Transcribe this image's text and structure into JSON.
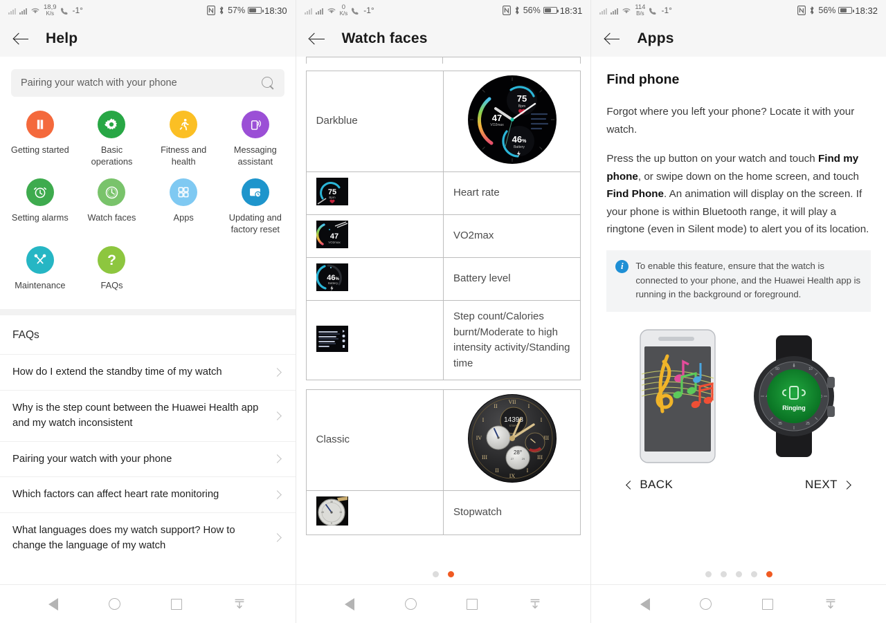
{
  "panels": [
    {
      "statusbar": {
        "net_rate_num": "18,9",
        "net_rate_unit": "K/s",
        "temp": "-1°",
        "nfc": "N",
        "bluetooth": "✽",
        "battery_pct": "57%",
        "clock": "18:30"
      },
      "appbar": {
        "title": "Help",
        "back_icon": "back-arrow-icon"
      },
      "search": {
        "value": "Pairing your watch with your phone",
        "icon": "search-icon"
      },
      "tiles": [
        {
          "label": "Getting started",
          "color": "#F4693C",
          "icon": "book-icon"
        },
        {
          "label": "Basic operations",
          "color": "#28A745",
          "icon": "gear-icon"
        },
        {
          "label": "Fitness and health",
          "color": "#FBBF24",
          "icon": "runner-icon"
        },
        {
          "label": "Messaging assistant",
          "color": "#9B4FD6",
          "icon": "phone-signal-icon"
        },
        {
          "label": "Setting alarms",
          "color": "#3EAB4E",
          "icon": "alarm-clock-icon"
        },
        {
          "label": "Watch faces",
          "color": "#79C36B",
          "icon": "clock-icon"
        },
        {
          "label": "Apps",
          "color": "#7FC9F2",
          "icon": "grid-apps-icon"
        },
        {
          "label": "Updating and factory reset",
          "color": "#1E95CC",
          "icon": "update-card-icon"
        },
        {
          "label": "Maintenance",
          "color": "#26B6C4",
          "icon": "tools-icon"
        },
        {
          "label": "FAQs",
          "color": "#8DC63F",
          "icon": "question-mark-icon"
        }
      ],
      "faq_section_title": "FAQs",
      "faqs": [
        "How do I extend the standby time of my watch",
        "Why is the step count between the Huawei Health app and my watch inconsistent",
        "Pairing your watch with your phone",
        "Which factors can affect heart rate monitoring",
        "What languages does my watch support? How to change the language of my watch"
      ]
    },
    {
      "statusbar": {
        "net_rate_num": "0",
        "net_rate_unit": "K/s",
        "temp": "-1°",
        "nfc": "N",
        "bluetooth": "✽",
        "battery_pct": "56%",
        "clock": "18:31"
      },
      "appbar": {
        "title": "Watch faces",
        "back_icon": "back-arrow-icon"
      },
      "table_rows": [
        {
          "type": "face",
          "name": "Darkblue",
          "art": "darkblue-face"
        },
        {
          "type": "thumb",
          "art": "heart-rate-thumb",
          "label": "Heart rate"
        },
        {
          "type": "thumb",
          "art": "vo2max-thumb",
          "label": "VO2max"
        },
        {
          "type": "thumb",
          "art": "battery-thumb",
          "label": "Battery level"
        },
        {
          "type": "thumb",
          "art": "activity-thumb",
          "label": "Step count/Calories burnt/Moderate to high intensity activity/Standing time"
        },
        {
          "type": "face",
          "name": "Classic",
          "art": "classic-face"
        },
        {
          "type": "thumb",
          "art": "stopwatch-thumb",
          "label": "Stopwatch"
        }
      ],
      "watch_face_values": {
        "darkblue": {
          "heart_rate": "75",
          "heart_rate_unit": "Bpm",
          "vo2max": "47",
          "vo2max_label": "VO2max",
          "battery": "46",
          "battery_unit": "%",
          "battery_label": "Battery"
        },
        "classic": {
          "steps": "14398",
          "steps_label": "STEPS",
          "temp": "28°"
        }
      },
      "dots": {
        "count": 2,
        "active_index": 1,
        "active_color": "#F05A22"
      }
    },
    {
      "statusbar": {
        "net_rate_num": "114",
        "net_rate_unit": "B/s",
        "temp": "-1°",
        "nfc": "N",
        "bluetooth": "✽",
        "battery_pct": "56%",
        "clock": "18:32"
      },
      "appbar": {
        "title": "Apps",
        "back_icon": "back-arrow-icon"
      },
      "heading": "Find phone",
      "para1": "Forgot where you left your phone? Locate it with your watch.",
      "para2": {
        "a": "Press the up button on your watch and touch ",
        "b1": "Find my phone",
        "c": ", or swipe down on the home screen, and touch ",
        "b2": "Find Phone",
        "d": ". An animation will display on the screen. If your phone is within Bluetooth range, it will play a ringtone (even in Silent mode) to alert you of its location."
      },
      "note": {
        "icon": "info-icon",
        "text": "To enable this feature, ensure that the watch is connected to your phone, and the Huawei Health app is running in the background or foreground."
      },
      "illustration": {
        "phone": "ringing-phone-illustration",
        "watch": "watch-ringing-illustration",
        "watch_label": "Ringing"
      },
      "pager": {
        "back": "BACK",
        "next": "NEXT"
      },
      "dots": {
        "count": 5,
        "active_index": 4,
        "active_color": "#F05A22"
      }
    }
  ],
  "navbar": {
    "items": [
      {
        "name": "nav-back-icon"
      },
      {
        "name": "nav-home-icon"
      },
      {
        "name": "nav-recents-icon"
      },
      {
        "name": "nav-notification-pull-icon"
      }
    ]
  }
}
